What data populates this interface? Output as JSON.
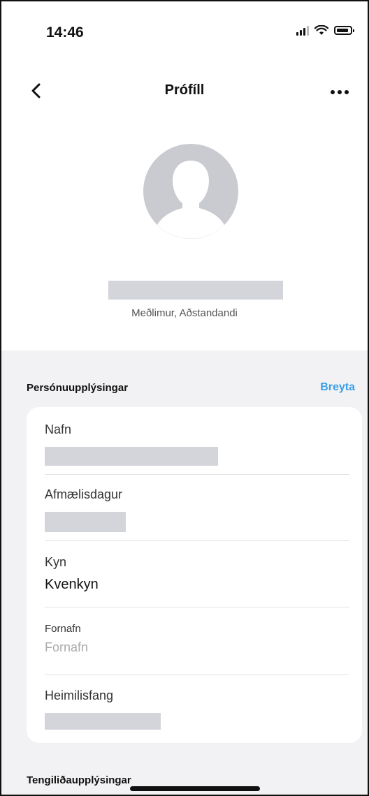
{
  "status": {
    "time": "14:46"
  },
  "nav": {
    "title": "Prófíll"
  },
  "profile": {
    "roles": "Meðlimur, Aðstandandi"
  },
  "personal": {
    "title": "Persónuupplýsingar",
    "edit_label": "Breyta",
    "fields": {
      "name_label": "Nafn",
      "birthday_label": "Afmælisdagur",
      "gender_label": "Kyn",
      "gender_value": "Kvenkyn",
      "pronoun_label": "Fornafn",
      "pronoun_placeholder": "Fornafn",
      "address_label": "Heimilisfang"
    }
  },
  "contact": {
    "title": "Tengiliðaupplýsingar"
  }
}
